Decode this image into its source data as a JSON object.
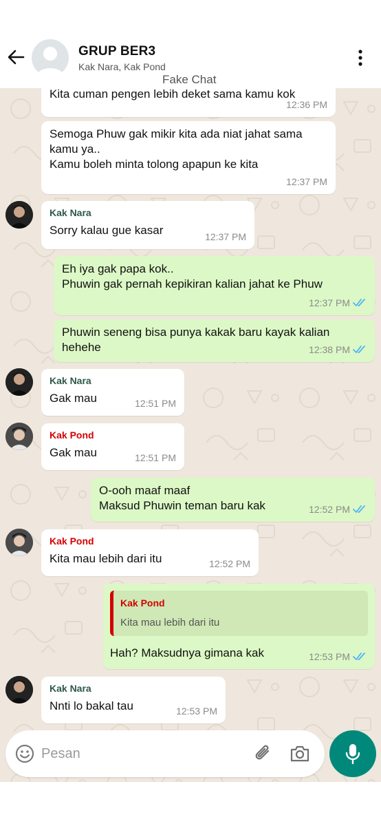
{
  "header": {
    "title": "GRUP BER3",
    "members": "Kak Nara, Kak Pond",
    "watermark": "Fake Chat"
  },
  "colors": {
    "header_bg": "#ffffff",
    "chat_bg": "#efe7dd",
    "incoming_bubble": "#ffffff",
    "outgoing_bubble": "#dcf8c6",
    "read_ticks": "#4fb3f6",
    "nara_name": "#2e5848",
    "pond_name": "#d40000",
    "mic_button": "#00897b"
  },
  "messages": [
    {
      "id": "m1",
      "side": "in",
      "text": "Kita cuman pengen lebih deket sama kamu kok",
      "time": "12:36 PM"
    },
    {
      "id": "m2",
      "side": "in",
      "lines": [
        "Semoga Phuw gak mikir kita ada niat jahat sama",
        "kamu ya..",
        "Kamu boleh minta tolong apapun ke kita"
      ],
      "time": "12:37 PM"
    },
    {
      "id": "m3",
      "side": "in",
      "sender": "Kak Nara",
      "text": "Sorry kalau gue kasar",
      "time": "12:37 PM"
    },
    {
      "id": "m4",
      "side": "out",
      "lines": [
        "Eh iya gak papa kok..",
        "Phuwin gak pernah kepikiran kalian jahat ke Phuw"
      ],
      "time": "12:37 PM",
      "status": "read"
    },
    {
      "id": "m5",
      "side": "out",
      "lines": [
        "Phuwin seneng bisa punya kakak baru kayak kalian",
        "hehehe"
      ],
      "time": "12:38 PM",
      "status": "read"
    },
    {
      "id": "m6",
      "side": "in",
      "sender": "Kak Nara",
      "text": "Gak mau",
      "time": "12:51 PM"
    },
    {
      "id": "m7",
      "side": "in",
      "sender": "Kak Pond",
      "text": "Gak mau",
      "time": "12:51 PM"
    },
    {
      "id": "m8",
      "side": "out",
      "lines": [
        "O-ooh maaf maaf",
        "Maksud Phuwin teman baru kak"
      ],
      "time": "12:52 PM",
      "status": "read"
    },
    {
      "id": "m9",
      "side": "in",
      "sender": "Kak Pond",
      "text": "Kita mau lebih dari itu",
      "time": "12:52 PM"
    },
    {
      "id": "m10",
      "side": "out",
      "reply": {
        "sender": "Kak Pond",
        "text": "Kita mau lebih dari itu"
      },
      "text": "Hah? Maksudnya gimana kak",
      "time": "12:53 PM",
      "status": "read"
    },
    {
      "id": "m11",
      "side": "in",
      "sender": "Kak Nara",
      "text": "Nnti lo bakal tau",
      "time": "12:53 PM"
    }
  ],
  "composer": {
    "placeholder": "Pesan",
    "icons": [
      "emoji-icon",
      "paperclip-icon",
      "camera-icon",
      "microphone-icon"
    ]
  }
}
